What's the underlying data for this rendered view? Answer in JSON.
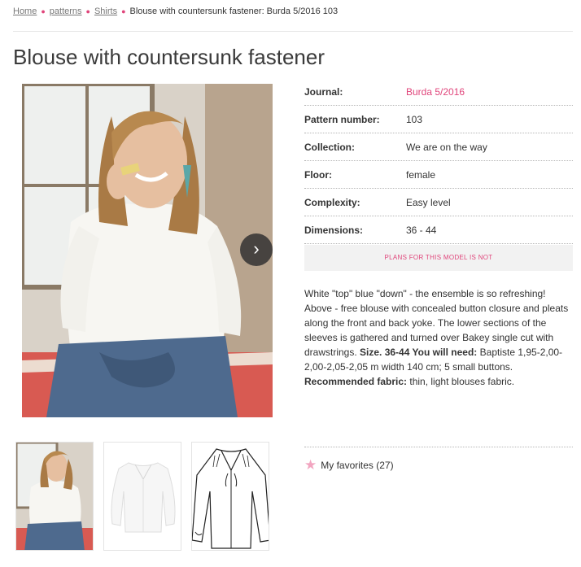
{
  "breadcrumb": {
    "home": "Home",
    "patterns": "patterns",
    "shirts": "Shirts",
    "current": "Blouse with countersunk fastener: Burda 5/2016 103"
  },
  "page_title": "Blouse with countersunk fastener",
  "details": [
    {
      "label": "Journal:",
      "value": "Burda 5/2016"
    },
    {
      "label": "Pattern number:",
      "value": "103"
    },
    {
      "label": "Collection:",
      "value": "We are on the way"
    },
    {
      "label": "Floor:",
      "value": "female"
    },
    {
      "label": "Complexity:",
      "value": "Easy level"
    },
    {
      "label": "Dimensions:",
      "value": "36 - 44"
    }
  ],
  "plans_banner": "PLANS FOR THIS MODEL IS NOT",
  "description": {
    "intro": "White \"top\" blue \"down\" - the ensemble is so refreshing! Above - free blouse with concealed button closure and pleats along the front and back yoke. The lower sections of the sleeves is gathered and turned over Bakey single cut with drawstrings.",
    "size_label": "Size. 36-44 You will need:",
    "size_text": "Baptiste 1,95-2,00-2,00-2,05-2,05 m width 140 cm; 5 small buttons.",
    "fabric_label": "Recommended fabric:",
    "fabric_text": "thin, light blouses fabric."
  },
  "favorites": {
    "label": "My favorites (27)"
  },
  "next_arrow": "›",
  "colors": {
    "accent": "#e0457b",
    "star": "#f2a5c0"
  }
}
